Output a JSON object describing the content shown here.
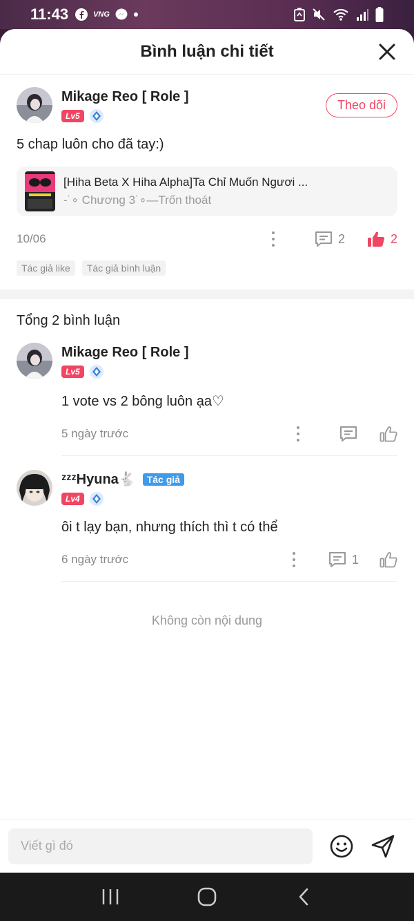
{
  "status_bar": {
    "time": "11:43",
    "left_icons": [
      "facebook-icon",
      "vng-icon",
      "messenger-icon",
      "dot-icon"
    ],
    "vng_label": "VNG",
    "right_icons": [
      "recycle-icon",
      "mute-icon",
      "wifi-icon",
      "signal-icon",
      "battery-icon"
    ]
  },
  "header": {
    "title": "Bình luận chi tiết"
  },
  "post": {
    "username": "Mikage Reo [ Role ]",
    "level": "Lv5",
    "follow_label": "Theo dõi",
    "text": "5 chap luôn cho đã tay:)",
    "story": {
      "title": "[Hiha Beta X Hiha Alpha]Ta Chỉ Muốn Ngươi ...",
      "chapter": "-˙∘ Chương 3˙∘—Trốn thoát"
    },
    "date": "10/06",
    "reply_count": "2",
    "like_count": "2",
    "tags": [
      "Tác giả like",
      "Tác giả bình luận"
    ]
  },
  "comments_header": "Tổng 2 bình luận",
  "comments": [
    {
      "username": "Mikage Reo [ Role ]",
      "level": "Lv5",
      "text": "1 vote vs 2 bông luôn ạa♡",
      "date": "5 ngày trước",
      "reply_count": ""
    },
    {
      "username": "ᶻᶻᶻHyuna🐇",
      "author_tag": "Tác giả",
      "level": "Lv4",
      "text": "ôi t lạy bạn, nhưng thích thì t có thể",
      "date": "6 ngày trước",
      "reply_count": "1"
    }
  ],
  "no_more": "Không còn nội dung",
  "input": {
    "placeholder": "Viết gì đó"
  },
  "colors": {
    "accent": "#f04664",
    "author_blue": "#3e9be9"
  }
}
